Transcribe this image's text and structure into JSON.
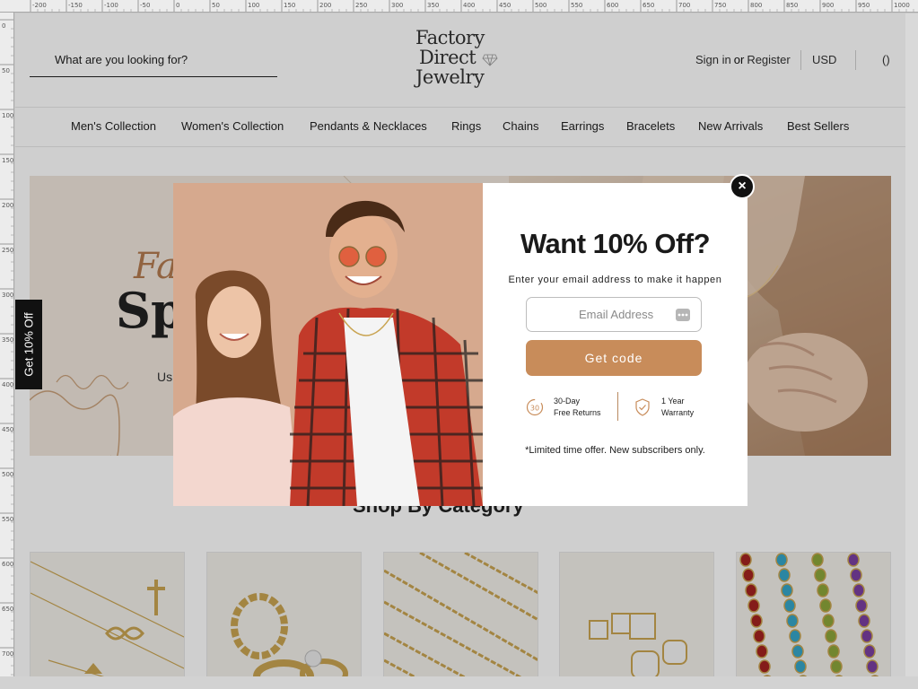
{
  "header": {
    "search_placeholder": "What are you looking for?",
    "logo_lines": [
      "Factory",
      "Direct",
      "Jewelry"
    ],
    "sign_in": "Sign in",
    "or": "or",
    "register": "Register",
    "currency": "USD",
    "cart": "()"
  },
  "nav": {
    "items": [
      "Men's Collection",
      "Women's Collection",
      "Pendants & Necklaces",
      "Rings",
      "Chains",
      "Earrings",
      "Bracelets",
      "New Arrivals",
      "Best Sellers"
    ]
  },
  "hero": {
    "script_text": "Fa",
    "big_text": "Sp",
    "sub_text": "Us"
  },
  "category": {
    "title": "Shop By Category"
  },
  "side_tab": {
    "label": "Get 10% Off"
  },
  "popup": {
    "title": "Want 10% Off?",
    "subtitle": "Enter your email address to make it happen",
    "email_placeholder": "Email Address",
    "button": "Get code",
    "benefits": [
      {
        "icon": "30-day-return-icon",
        "badge": "30",
        "line1": "30-Day",
        "line2": "Free Returns"
      },
      {
        "icon": "shield-check-icon",
        "line1": "1 Year",
        "line2": "Warranty"
      }
    ],
    "fine_print": "*Limited time offer. New subscribers only.",
    "close": "×"
  },
  "rulers": {
    "top_labels": [
      "-200",
      "-150",
      "-100",
      "-50",
      "0",
      "50",
      "100",
      "150",
      "200",
      "250",
      "300",
      "350",
      "400",
      "450",
      "500",
      "550",
      "600",
      "650",
      "700",
      "750",
      "800",
      "850",
      "900",
      "950",
      "1000"
    ],
    "left_labels": [
      "0",
      "50",
      "100",
      "150",
      "200",
      "250",
      "300",
      "350",
      "400",
      "450",
      "500",
      "550",
      "600",
      "650",
      "700"
    ]
  },
  "colors": {
    "accent": "#c88c5a",
    "dark": "#111111",
    "overlay": "rgba(0,0,0,0.19)"
  }
}
